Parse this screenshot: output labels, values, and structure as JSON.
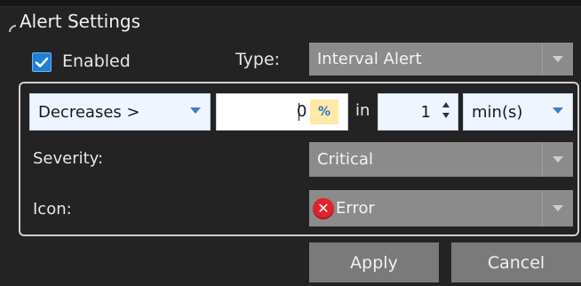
{
  "panel": {
    "title": "Alert Settings"
  },
  "enabled": {
    "label": "Enabled",
    "checked": true
  },
  "type": {
    "label": "Type:",
    "value": "Interval Alert"
  },
  "condition": {
    "operator": "Decreases >",
    "amount": "0",
    "unit_badge": "%",
    "in_label": "in",
    "interval_value": "1",
    "interval_unit": "min(s)"
  },
  "severity": {
    "label": "Severity:",
    "value": "Critical"
  },
  "icon": {
    "label": "Icon:",
    "value": "Error",
    "icon_name": "error-icon"
  },
  "buttons": {
    "apply": "Apply",
    "cancel": "Cancel"
  },
  "colors": {
    "accent": "#1f7fd8",
    "error": "#e0232b",
    "highlight": "#ffe9a6"
  }
}
